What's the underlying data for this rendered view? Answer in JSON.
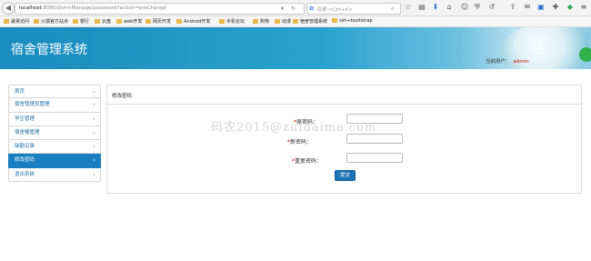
{
  "browser": {
    "url_host": "localhost",
    "url_rest": ":8080/DormManage/password?action=preChange",
    "search_placeholder": "百度 <Ctrl+K>",
    "bookmarks": [
      "最常访问",
      "火狐官方站点",
      "银行",
      "云盘",
      "web开发",
      "网页开发",
      "Android开发",
      "手机论坛",
      "购物",
      "动漫",
      "宿舍管理系统",
      "ssh+bootstrap"
    ]
  },
  "header": {
    "title": "宿舍管理系统",
    "user_prefix": "当前用户：",
    "user_name": "admin"
  },
  "sidebar": {
    "items": [
      {
        "label": "首页",
        "active": false
      },
      {
        "label": "宿舍管理员管理",
        "active": false
      },
      {
        "label": "学生管理",
        "active": false
      },
      {
        "label": "宿舍楼管理",
        "active": false
      },
      {
        "label": "缺勤记录",
        "active": false
      },
      {
        "label": "修改密码",
        "active": true
      },
      {
        "label": "退出系统",
        "active": false
      }
    ]
  },
  "panel": {
    "title": "修改密码",
    "fields": [
      {
        "required_mark": "*",
        "label": "原密码："
      },
      {
        "required_mark": "*",
        "label": "新密码："
      },
      {
        "required_mark": "*",
        "label": "重复密码："
      }
    ],
    "submit_label": "提交"
  },
  "watermark": "码农2015@zuidaima.com",
  "colors": {
    "header_blue": "#1a8bbf",
    "active_item": "#1a7fc1",
    "submit_button": "#1d73b8",
    "user_name": "#cc0000"
  }
}
